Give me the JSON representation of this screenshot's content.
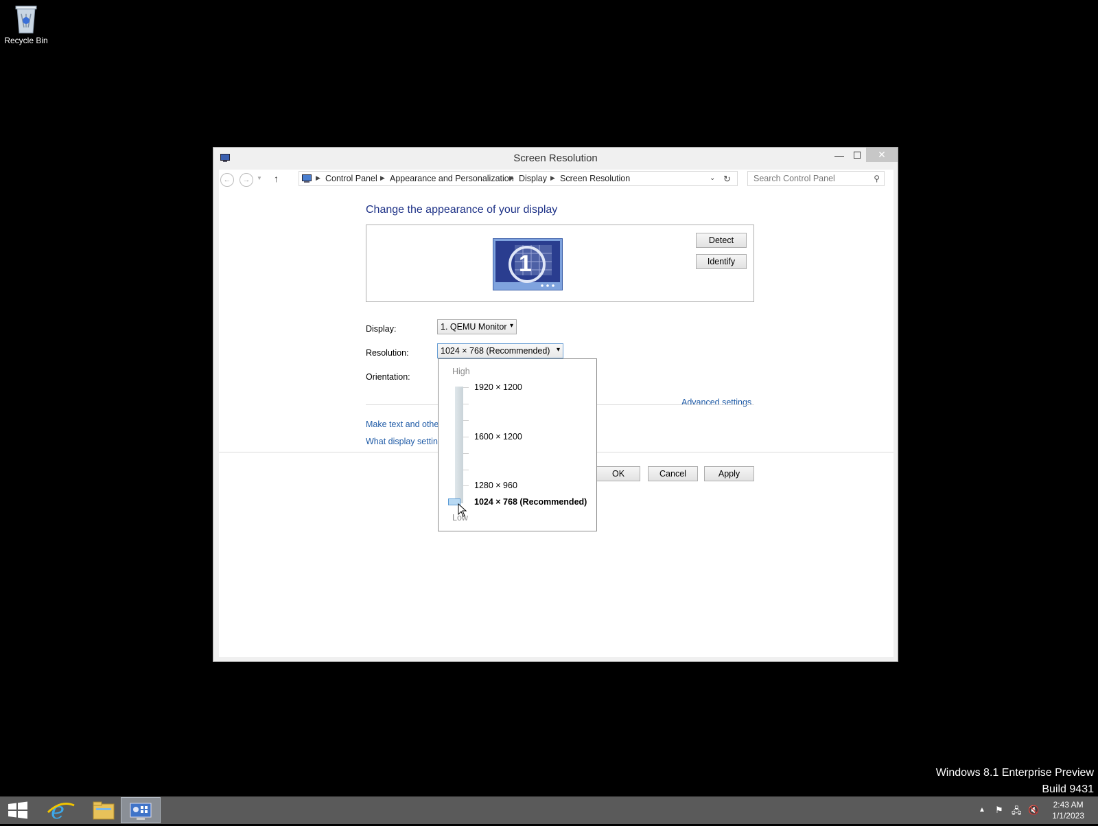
{
  "desktop": {
    "recycle_bin_label": "Recycle Bin",
    "watermark_line1": "Windows 8.1 Enterprise Preview",
    "watermark_line2": "Build 9431"
  },
  "window": {
    "title": "Screen Resolution",
    "close_glyph": "✕",
    "minimize_glyph": "—",
    "maximize_glyph": "☐",
    "nav": {
      "back_icon": "back-arrow-icon",
      "forward_icon": "forward-arrow-icon",
      "up_icon": "up-arrow-icon",
      "breadcrumbs": [
        "Control Panel",
        "Appearance and Personalization",
        "Display",
        "Screen Resolution"
      ],
      "search_placeholder": "Search Control Panel"
    },
    "content": {
      "heading": "Change the appearance of your display",
      "monitor_number": "1",
      "detect_label": "Detect",
      "identify_label": "Identify",
      "display_label": "Display:",
      "display_value": "1. QEMU Monitor",
      "resolution_label": "Resolution:",
      "resolution_value": "1024 × 768 (Recommended)",
      "orientation_label": "Orientation:",
      "advanced_link": "Advanced settings",
      "link_text_size": "Make text and other",
      "link_display_settings": "What display setting",
      "ok_label": "OK",
      "cancel_label": "Cancel",
      "apply_label": "Apply"
    },
    "resolution_dropdown": {
      "high_label": "High",
      "low_label": "Low",
      "options": [
        "1920 × 1200",
        "1600 × 1200",
        "1280 × 960",
        "1024 × 768 (Recommended)"
      ],
      "selected": "1024 × 768 (Recommended)"
    }
  },
  "taskbar": {
    "items": [
      "start-icon",
      "internet-explorer-icon",
      "file-explorer-icon",
      "control-panel-icon"
    ],
    "clock_time": "2:43 AM",
    "clock_date": "1/1/2023"
  },
  "colors": {
    "heading_blue": "#1e3287",
    "link_blue": "#1e5aa6",
    "taskbar_gray": "#5a5a5a",
    "desktop_black": "#000000"
  }
}
